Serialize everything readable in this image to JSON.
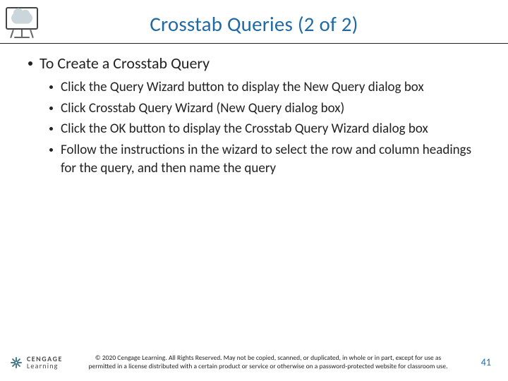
{
  "title": "Crosstab Queries (2 of 2)",
  "heading": "To Create a Crosstab Query",
  "bullets": [
    "Click the Query Wizard button to display the New Query dialog box",
    "Click Crosstab Query Wizard (New Query dialog box)",
    "Click the OK button to display the Crosstab Query Wizard dialog box",
    "Follow the instructions in the wizard to select the row and column headings for the query, and then name the query"
  ],
  "logo": {
    "top": "CENGAGE",
    "bottom": "Learning"
  },
  "copyright": "© 2020 Cengage Learning. All Rights Reserved. May not be copied, scanned, or duplicated, in whole or in part, except for use as permitted in a license distributed with a certain product or service or otherwise on a password-protected website for classroom use.",
  "pageNumber": "41",
  "colors": {
    "accent": "#1f6aa5",
    "rule": "#222222"
  }
}
